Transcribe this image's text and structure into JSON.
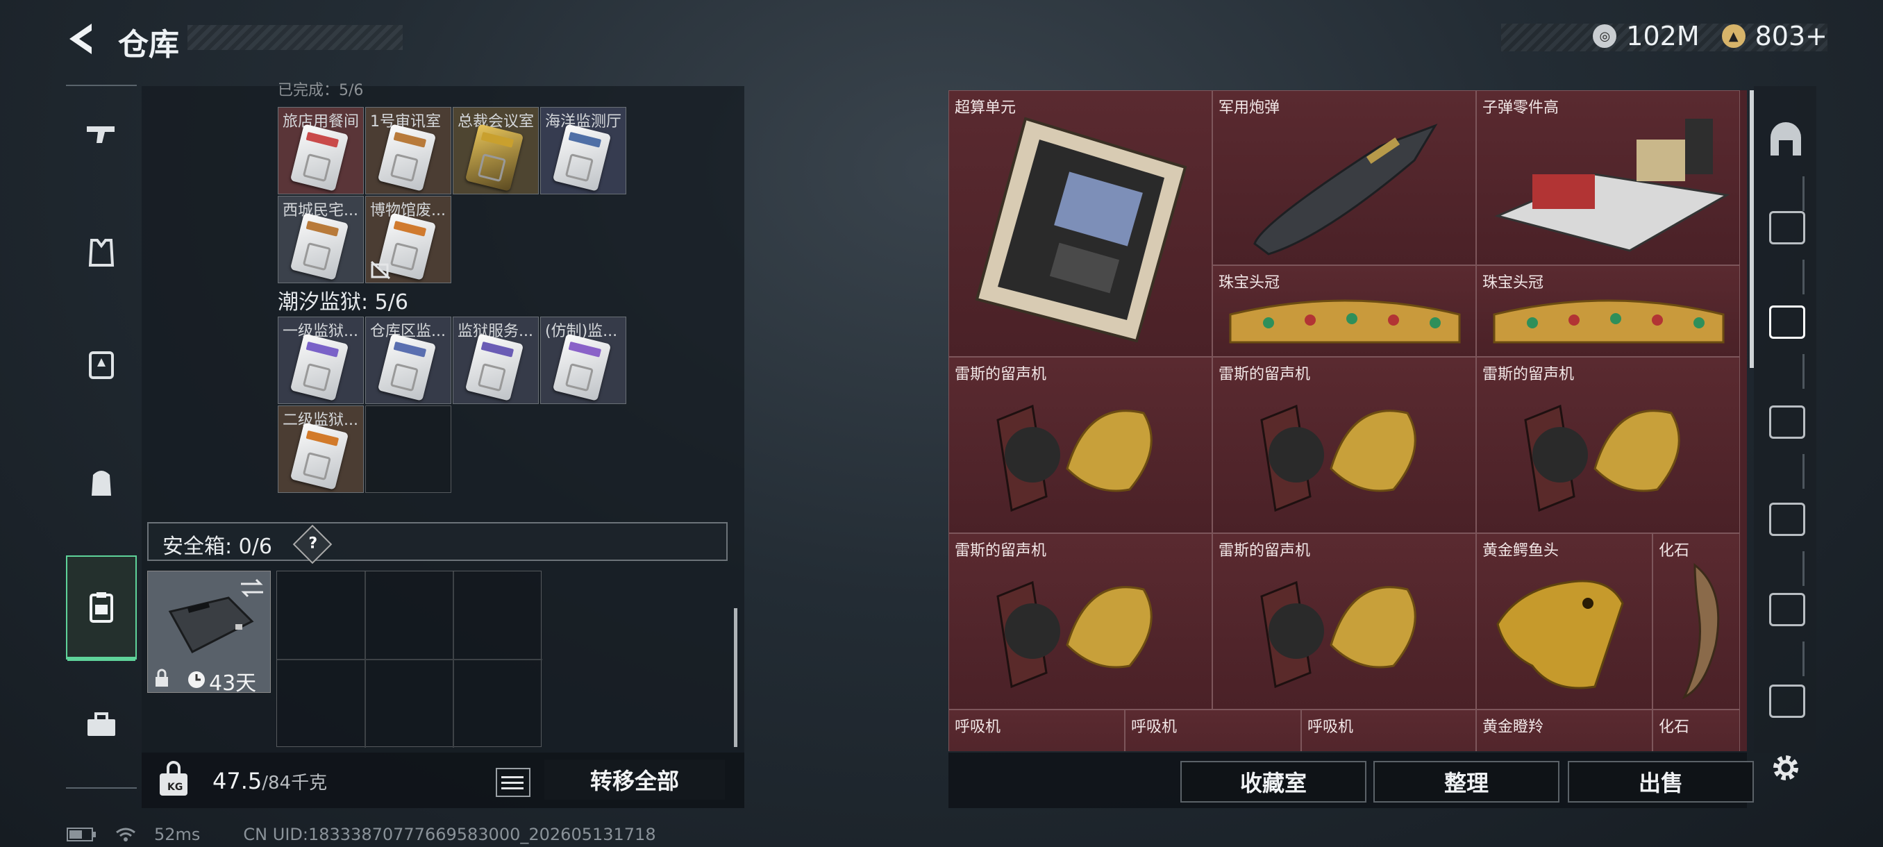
{
  "header": {
    "title": "仓库",
    "currency_1": "102M",
    "currency_2": "803+"
  },
  "keycards_group_a": {
    "truncated_title": "已完成：5/6",
    "items": [
      {
        "label": "旅店用餐间",
        "band": "#c94a4a"
      },
      {
        "label": "1号审讯室",
        "band": "#b87a3a"
      },
      {
        "label": "总裁会议室",
        "band": "#c9a02e"
      },
      {
        "label": "海洋监测厅",
        "band": "#4f6fa6"
      },
      {
        "label": "西城民宅...",
        "band": "#b87a3a"
      },
      {
        "label": "博物馆废...",
        "band": "#d07a2e"
      }
    ]
  },
  "keycards_group_b": {
    "title": "潮汐监狱: 5/6",
    "items": [
      {
        "label": "一级监狱...",
        "band": "#7a62c8"
      },
      {
        "label": "仓库区监...",
        "band": "#5a6fb0"
      },
      {
        "label": "监狱服务...",
        "band": "#6a5cb5"
      },
      {
        "label": "(仿制)监...",
        "band": "#8a62c8"
      },
      {
        "label": "二级监狱...",
        "band": "#d27a2a"
      }
    ]
  },
  "safe_box": {
    "label": "安全箱: 0/6",
    "help": "?",
    "duration": "43天"
  },
  "footer_left": {
    "weight": "47.5",
    "weight_max": "/84千克",
    "transfer_all": "转移全部"
  },
  "right_items": [
    {
      "label": "超算单元"
    },
    {
      "label": "军用炮弹"
    },
    {
      "label": "子弹零件高"
    },
    {
      "label": "珠宝头冠"
    },
    {
      "label": "珠宝头冠"
    },
    {
      "label": "雷斯的留声机"
    },
    {
      "label": "雷斯的留声机"
    },
    {
      "label": "雷斯的留声机"
    },
    {
      "label": "雷斯的留声机"
    },
    {
      "label": "雷斯的留声机"
    },
    {
      "label": "黄金鳄鱼头"
    },
    {
      "label": "化石"
    },
    {
      "label": "呼吸机"
    },
    {
      "label": "呼吸机"
    },
    {
      "label": "呼吸机"
    },
    {
      "label": "黄金瞪羚"
    },
    {
      "label": "化石"
    }
  ],
  "footer_right": {
    "collection": "收藏室",
    "sort": "整理",
    "sell": "出售"
  },
  "status_bar": {
    "ping": "52ms",
    "uid": "CN UID:18333870777669583000_202605131718"
  },
  "colors": {
    "accent": "#5fd39a",
    "item_bg": "#4b2228"
  },
  "icons": [
    "back-arrow-icon",
    "gun-icon",
    "armor-vest-icon",
    "chest-rig-icon",
    "backpack-icon",
    "safe-box-icon",
    "toolbox-icon",
    "weight-icon",
    "list-icon",
    "gear-icon",
    "battery-icon",
    "wifi-icon"
  ]
}
